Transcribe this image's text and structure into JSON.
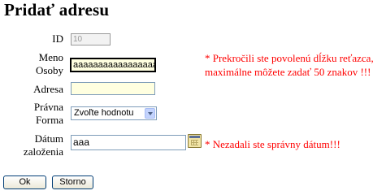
{
  "page_title": "Pridať adresu",
  "form": {
    "id": {
      "label": "ID",
      "value": "10"
    },
    "name": {
      "label_line1": "Meno",
      "label_line2": "Osoby",
      "value": "aaaaaaaaaaaaaaaaa"
    },
    "address": {
      "label": "Adresa",
      "value": ""
    },
    "legal_form": {
      "label_line1": "Právna",
      "label_line2": "Forma",
      "selected": "Zvoľte hodnotu"
    },
    "date": {
      "label_line1": "Dátum",
      "label_line2": "založenia",
      "value": "aaa"
    }
  },
  "errors": {
    "name_line1": "* Prekročili ste povolenú dĺžku reťazca,",
    "name_line2": "maximálne môžete zadať 50 znakov !!!",
    "date": "* Nezadali ste správny dátum!!!"
  },
  "icons": {
    "calendar": "calendar-icon",
    "dropdown": "chevron-down-icon"
  },
  "colors": {
    "error": "#ff0000",
    "input_bg": "#ffffe0"
  },
  "buttons": {
    "ok": "Ok",
    "cancel": "Storno"
  }
}
